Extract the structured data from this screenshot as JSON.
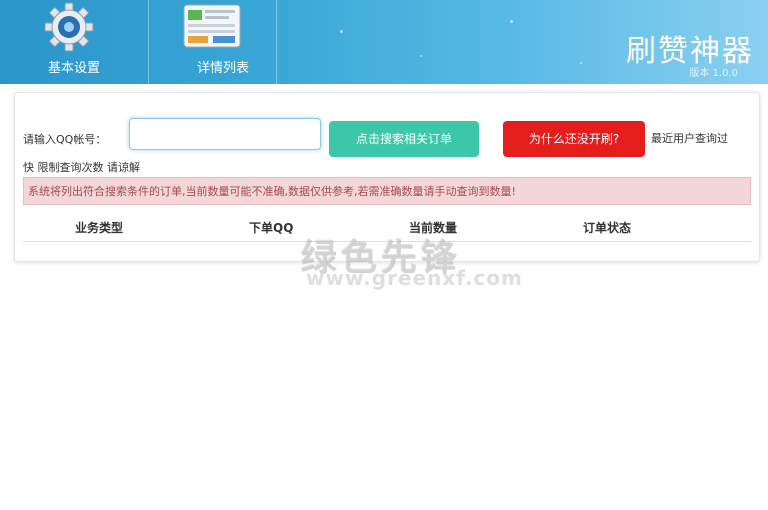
{
  "header": {
    "tabs": [
      {
        "label": "基本设置",
        "icon": "gear-icon"
      },
      {
        "label": "详情列表",
        "icon": "list-panel-icon"
      }
    ],
    "app_title": "刷赞神器",
    "version": "版本 1.0.0"
  },
  "form": {
    "qq_label": "请输入QQ帐号：",
    "qq_value": "",
    "search_button": "点击搜索相关订单",
    "why_button": "为什么还没开刷?",
    "recent_text": "最近用户查询过",
    "fast_text": "快 限制查询次数 请谅解"
  },
  "notice": "系统将列出符合搜索条件的订单,当前数量可能不准确,数据仅供参考,若需准确数量请手动查询到数量!",
  "table": {
    "columns": [
      "业务类型",
      "下单QQ",
      "当前数量",
      "订单状态"
    ]
  },
  "watermark": {
    "cn": "绿色先锋",
    "url": "www.greenxf.com"
  },
  "colors": {
    "header_blue": "#3aa7d8",
    "search_green": "#3cc8a8",
    "why_red": "#e41d1d",
    "notice_bg": "#f3d6d8"
  }
}
